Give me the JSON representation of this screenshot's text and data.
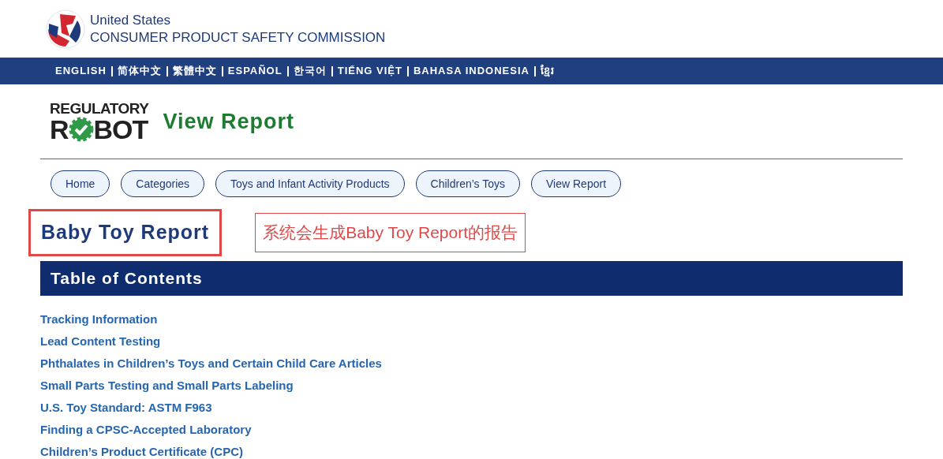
{
  "agency": {
    "line1": "United States",
    "line2": "CONSUMER PRODUCT SAFETY COMMISSION"
  },
  "languages": [
    "ENGLISH",
    "简体中文",
    "繁體中文",
    "ESPAÑOL",
    "한국어",
    "TIẾNG VIỆT",
    "BAHASA INDONESIA",
    "ខ្មែរ"
  ],
  "logo": {
    "top": "REGULATORY",
    "left": "R",
    "right": "BOT"
  },
  "page_title": "View Report",
  "breadcrumbs": [
    "Home",
    "Categories",
    "Toys and Infant Activity Products",
    "Children’s Toys",
    "View Report"
  ],
  "report_title": "Baby Toy Report",
  "annotation": "系统会生成Baby Toy Report的报告",
  "toc": {
    "heading": "Table of Contents",
    "links": [
      "Tracking Information",
      "Lead Content Testing",
      "Phthalates in Children’s Toys and Certain Child Care Articles",
      "Small Parts Testing and Small Parts Labeling",
      "U.S. Toy Standard: ASTM F963",
      "Finding a CPSC-Accepted Laboratory",
      "Children’s Product Certificate (CPC)"
    ]
  }
}
